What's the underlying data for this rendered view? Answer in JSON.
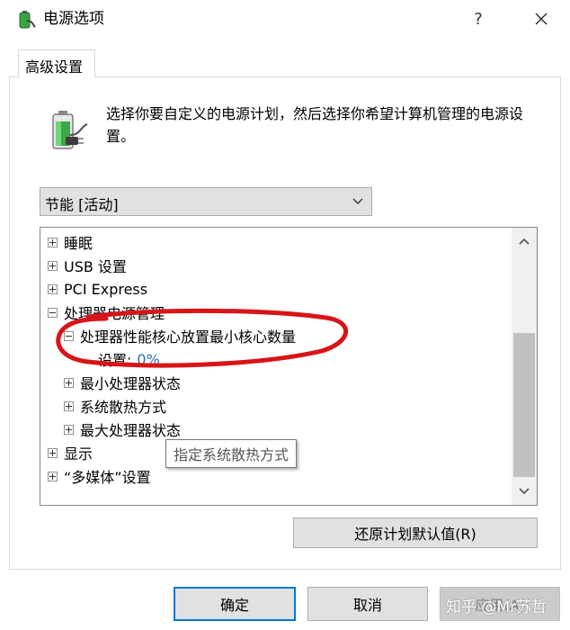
{
  "window": {
    "title": "电源选项",
    "help_glyph": "?",
    "icon": "power-options-icon"
  },
  "tab": {
    "label": "高级设置"
  },
  "description": "选择你要自定义的电源计划，然后选择你希望计算机管理的电源设置。",
  "plan_select": {
    "value": "节能 [活动]"
  },
  "tree": {
    "items": [
      {
        "label": "睡眠"
      },
      {
        "label": "USB 设置"
      },
      {
        "label": "PCI Express"
      },
      {
        "label": "处理器电源管理"
      },
      {
        "label": "处理器性能核心放置最小核心数量"
      },
      {
        "label": "设置:",
        "value": "0%"
      },
      {
        "label": "最小处理器状态"
      },
      {
        "label": "系统散热方式"
      },
      {
        "label": "最大处理器状态"
      },
      {
        "label": "显示"
      },
      {
        "label": "“多媒体”设置"
      }
    ]
  },
  "tooltip": {
    "text": "指定系统散热方式"
  },
  "buttons": {
    "restore": "还原计划默认值(R)",
    "ok": "确定",
    "cancel": "取消",
    "apply": "应用(A)"
  },
  "watermark": "知乎 @Mr苏哲",
  "colors": {
    "accent": "#0078d7",
    "annotation": "#d81418",
    "setting_value": "#2a6fb5"
  }
}
